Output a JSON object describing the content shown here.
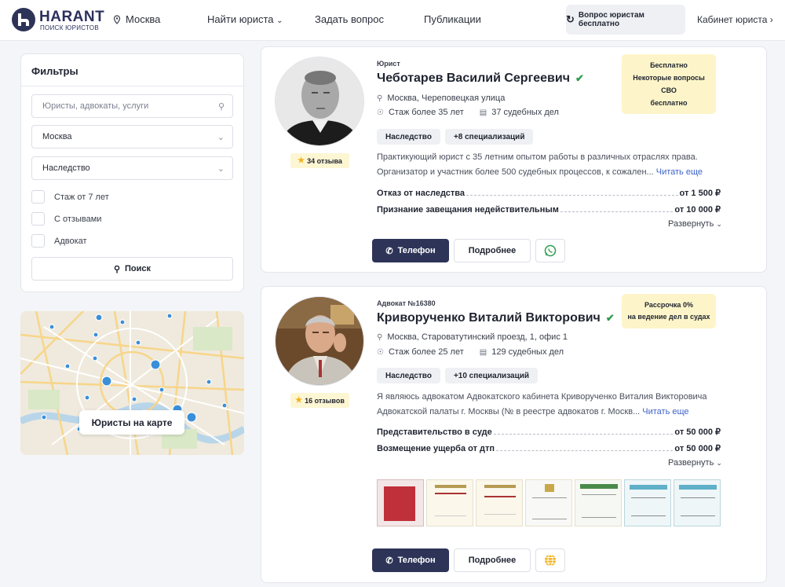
{
  "header": {
    "logo_title": "HARANT",
    "logo_subtitle": "ПОИСК ЮРИСТОВ",
    "city": "Москва",
    "nav": [
      "Найти юриста",
      "Задать вопрос",
      "Публикации"
    ],
    "free_question": "Вопрос юристам бесплатно",
    "cabinet": "Кабинет юриста"
  },
  "filters": {
    "title": "Фильтры",
    "search_placeholder": "Юристы, адвокаты, услуги",
    "city_value": "Москва",
    "category_value": "Наследство",
    "checkboxes": [
      "Стаж от 7 лет",
      "С отзывами",
      "Адвокат"
    ],
    "search_button": "Поиск"
  },
  "map": {
    "button": "Юристы на карте"
  },
  "cards": [
    {
      "kind": "Юрист",
      "name": "Чеботарев Василий Сергеевич",
      "reviews": "34 отзыва",
      "badge": [
        "Бесплатно",
        "Некоторые вопросы СВО",
        "бесплатно"
      ],
      "address": "Москва, Череповецкая улица",
      "experience": "Стаж более 35 лет",
      "cases": "37 судебных дел",
      "tags": [
        "Наследство",
        "+8 специализаций"
      ],
      "desc_line1": "Практикующий юрист с 35 летним опытом работы в различных отраслях права.",
      "desc_line2": "Организатор и участник более 500 судебных процессов, к сожален...",
      "read_more": "Читать еще",
      "prices": [
        {
          "label": "Отказ от наследства",
          "value": "от 1 500 ₽"
        },
        {
          "label": "Признание завещания недействительным",
          "value": "от 10 000 ₽"
        }
      ],
      "expand": "Развернуть",
      "phone_button": "Телефон",
      "more_button": "Подробнее"
    },
    {
      "kind": "Адвокат №16380",
      "name": "Криворученко Виталий Викторович",
      "reviews": "16 отзывов",
      "badge": [
        "Рассрочка 0%",
        "на ведение дел в судах"
      ],
      "address": "Москва, Староватутинский проезд, 1, офис 1",
      "experience": "Стаж более 25 лет",
      "cases": "129 судебных дел",
      "tags": [
        "Наследство",
        "+10 специализаций"
      ],
      "desc_line1": "Я являюсь адвокатом Адвокатского кабинета Криворученко Виталия Викторовича",
      "desc_line2": "Адвокатской палаты г. Москвы (№ в реестре адвокатов г. Москв...",
      "read_more": "Читать еще",
      "prices": [
        {
          "label": "Представительство в суде",
          "value": "от 50 000 ₽"
        },
        {
          "label": "Возмещение ущерба от дтп",
          "value": "от 50 000 ₽"
        }
      ],
      "expand": "Развернуть",
      "phone_button": "Телефон",
      "more_button": "Подробнее"
    }
  ],
  "colors": {
    "brand": "#2d3458",
    "badge": "#fdf5c9",
    "link": "#3e63c8",
    "verified": "#2e9b4e"
  }
}
